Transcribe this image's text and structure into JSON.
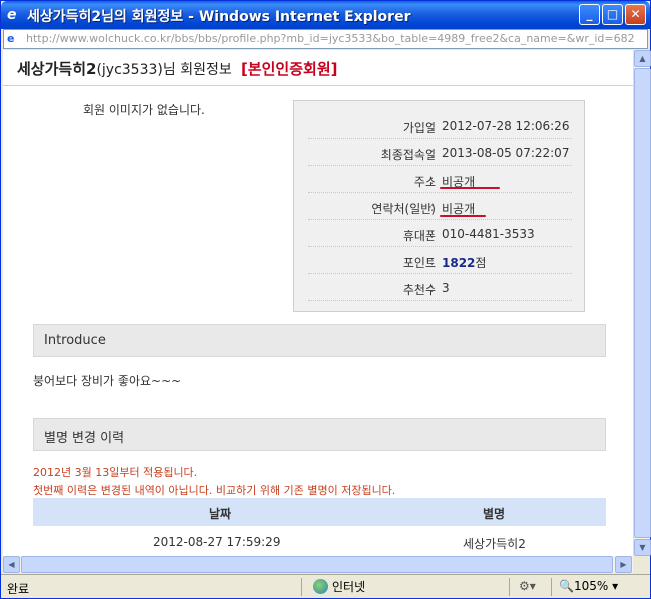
{
  "window": {
    "title": "세상가득히2님의 회원정보 - Windows Internet Explorer",
    "address": "http://www.wolchuck.co.kr/bbs/bbs/profile.php?mb_id=jyc3533&bo_table=4989_free2&ca_name=&wr_id=682"
  },
  "profile": {
    "nick": "세상가득히2",
    "id_part": "(jyc3533)",
    "suffix": "님 회원정보",
    "badge": "[본인인증회원]",
    "no_image": "회원 이미지가 없습니다.",
    "rows": [
      {
        "label": "가입일",
        "value": "2012-07-28 12:06:26"
      },
      {
        "label": "최종접속일",
        "value": "2013-08-05 07:22:07"
      },
      {
        "label": "주소",
        "value": "비공개"
      },
      {
        "label": "연락처(일반)",
        "value": "비공개"
      },
      {
        "label": "휴대폰",
        "value": "010-4481-3533"
      },
      {
        "label": "포인트",
        "value_bold": "1822",
        "value_suffix": "점"
      },
      {
        "label": "추천수",
        "value": "3"
      }
    ]
  },
  "introduce": {
    "heading": "Introduce",
    "text": "붕어보다 장비가 좋아요~~~"
  },
  "nick_history": {
    "heading": "별명 변경 이력",
    "notice1": "2012년 3월 13일부터 적용됩니다.",
    "notice2": "첫번째 이력은 변경된 내역이 아닙니다. 비교하기 위해 기존 별명이 저장됩니다.",
    "columns": [
      "날짜",
      "별명"
    ],
    "rows": [
      {
        "date": "2012-08-27 17:59:29",
        "nick": "세상가득히2"
      }
    ]
  },
  "status": {
    "left": "완료",
    "zone": "인터넷",
    "zoom": "105%"
  },
  "colors": {
    "badge": "#c8001e",
    "notice": "#c8401e",
    "underline": "#c8102e",
    "table_header": "#d4e3f7"
  }
}
